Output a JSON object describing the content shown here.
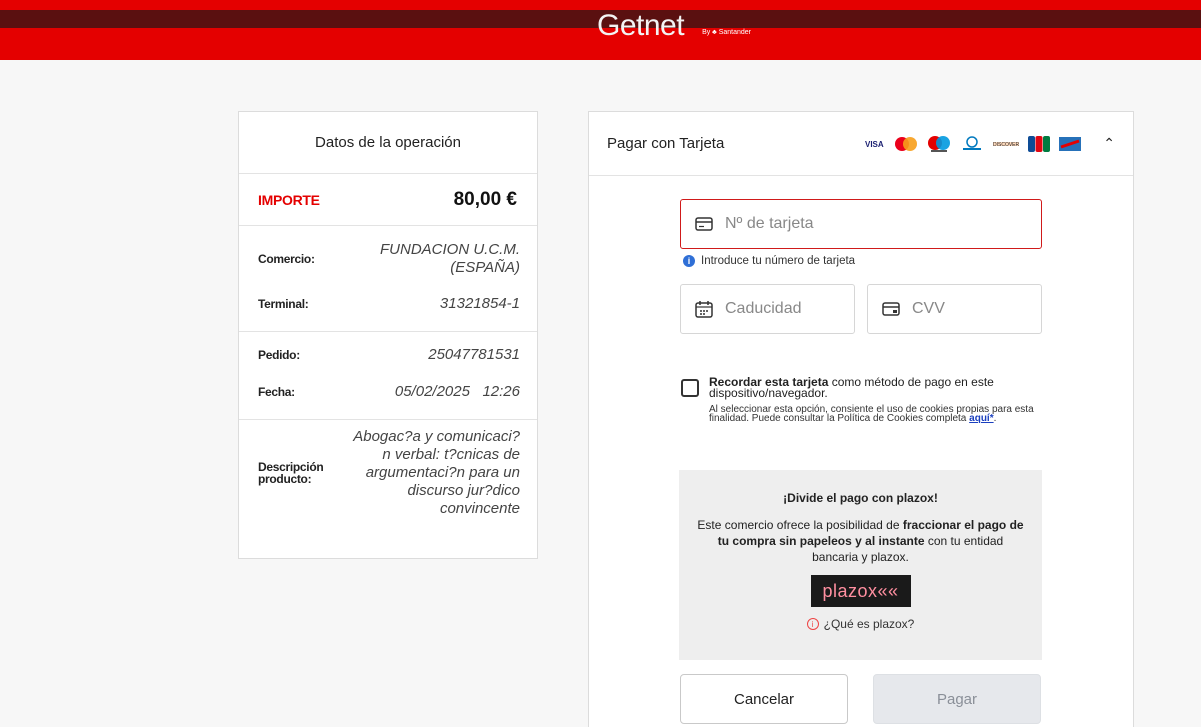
{
  "brand": {
    "name": "Getnet",
    "by": "By ♣ Santander"
  },
  "operation": {
    "title": "Datos de la operación",
    "amount_label": "IMPORTE",
    "amount_value": "80,00 €",
    "fields": [
      {
        "label": "Comercio:",
        "value": "FUNDACION U.C.M. (ESPAÑA)"
      },
      {
        "label": "Terminal:",
        "value": "31321854-1"
      },
      {
        "label": "Pedido:",
        "value": "25047781531"
      },
      {
        "label": "Fecha:",
        "value": "05/02/2025   12:26"
      },
      {
        "label": "Descripción producto:",
        "value": "Abogac?a y comunicaci?n verbal: t?cnicas de argumentaci?n para un discurso jur?dico convincente"
      }
    ]
  },
  "payment": {
    "title": "Pagar con Tarjeta",
    "card_brands": [
      "visa",
      "mastercard",
      "maestro",
      "diners",
      "discover",
      "jcb",
      "amex"
    ],
    "card_number_placeholder": "Nº de tarjeta",
    "card_number_hint": "Introduce tu número de tarjeta",
    "expiry_placeholder": "Caducidad",
    "cvv_placeholder": "CVV",
    "remember_bold": "Recordar esta tarjeta",
    "remember_rest": " como método de pago en este dispositivo/navegador.",
    "remember_note": "Al seleccionar esta opción, consiente el uso de cookies propias para esta finalidad. Puede consultar la Política de Cookies completa ",
    "remember_link": "aquí*",
    "remember_note_end": ".",
    "plazox": {
      "title": "¡Divide el pago con plazox!",
      "body_1": "Este comercio ofrece la posibilidad de ",
      "body_bold": "fraccionar el pago de tu compra sin papeleos y al instante",
      "body_2": " con tu entidad bancaria y plazox.",
      "logo": "plazox««",
      "what": "¿Qué es plazox?"
    },
    "cancel_label": "Cancelar",
    "pay_label": "Pagar"
  }
}
